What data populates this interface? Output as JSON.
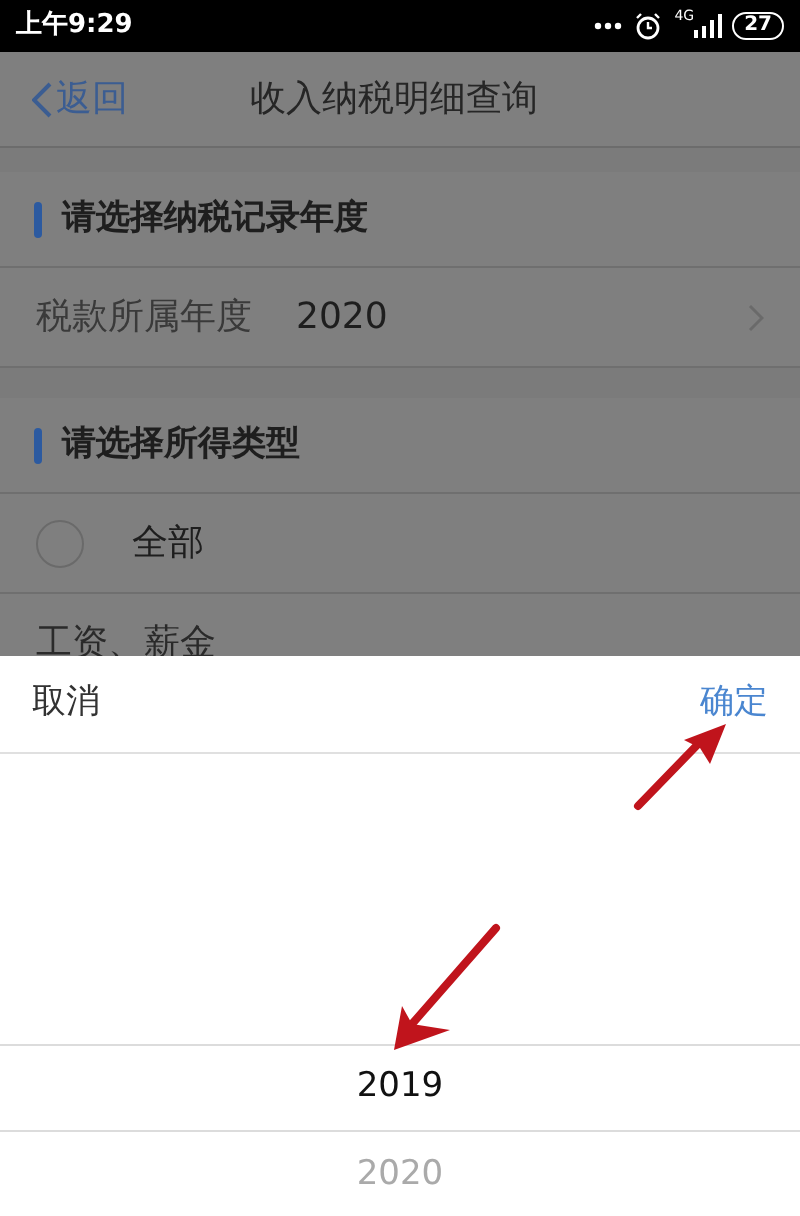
{
  "status_bar": {
    "time": "上午9:29",
    "network": "4G",
    "battery": "27"
  },
  "nav_bar": {
    "back": "返回",
    "title": "收入纳税明细查询"
  },
  "sections": [
    {
      "title": "请选择纳税记录年度",
      "rows": [
        {
          "kind": "value",
          "label": "税款所属年度",
          "value": "2020"
        }
      ]
    },
    {
      "title": "请选择所得类型",
      "rows": [
        {
          "kind": "radio",
          "label": "全部",
          "selected": false
        },
        {
          "kind": "plain",
          "label": "工资、薪金"
        }
      ]
    }
  ],
  "picker": {
    "cancel": "取消",
    "confirm": "确定",
    "items": [
      {
        "label": "2019",
        "selected": true
      },
      {
        "label": "2020",
        "selected": false
      }
    ]
  }
}
